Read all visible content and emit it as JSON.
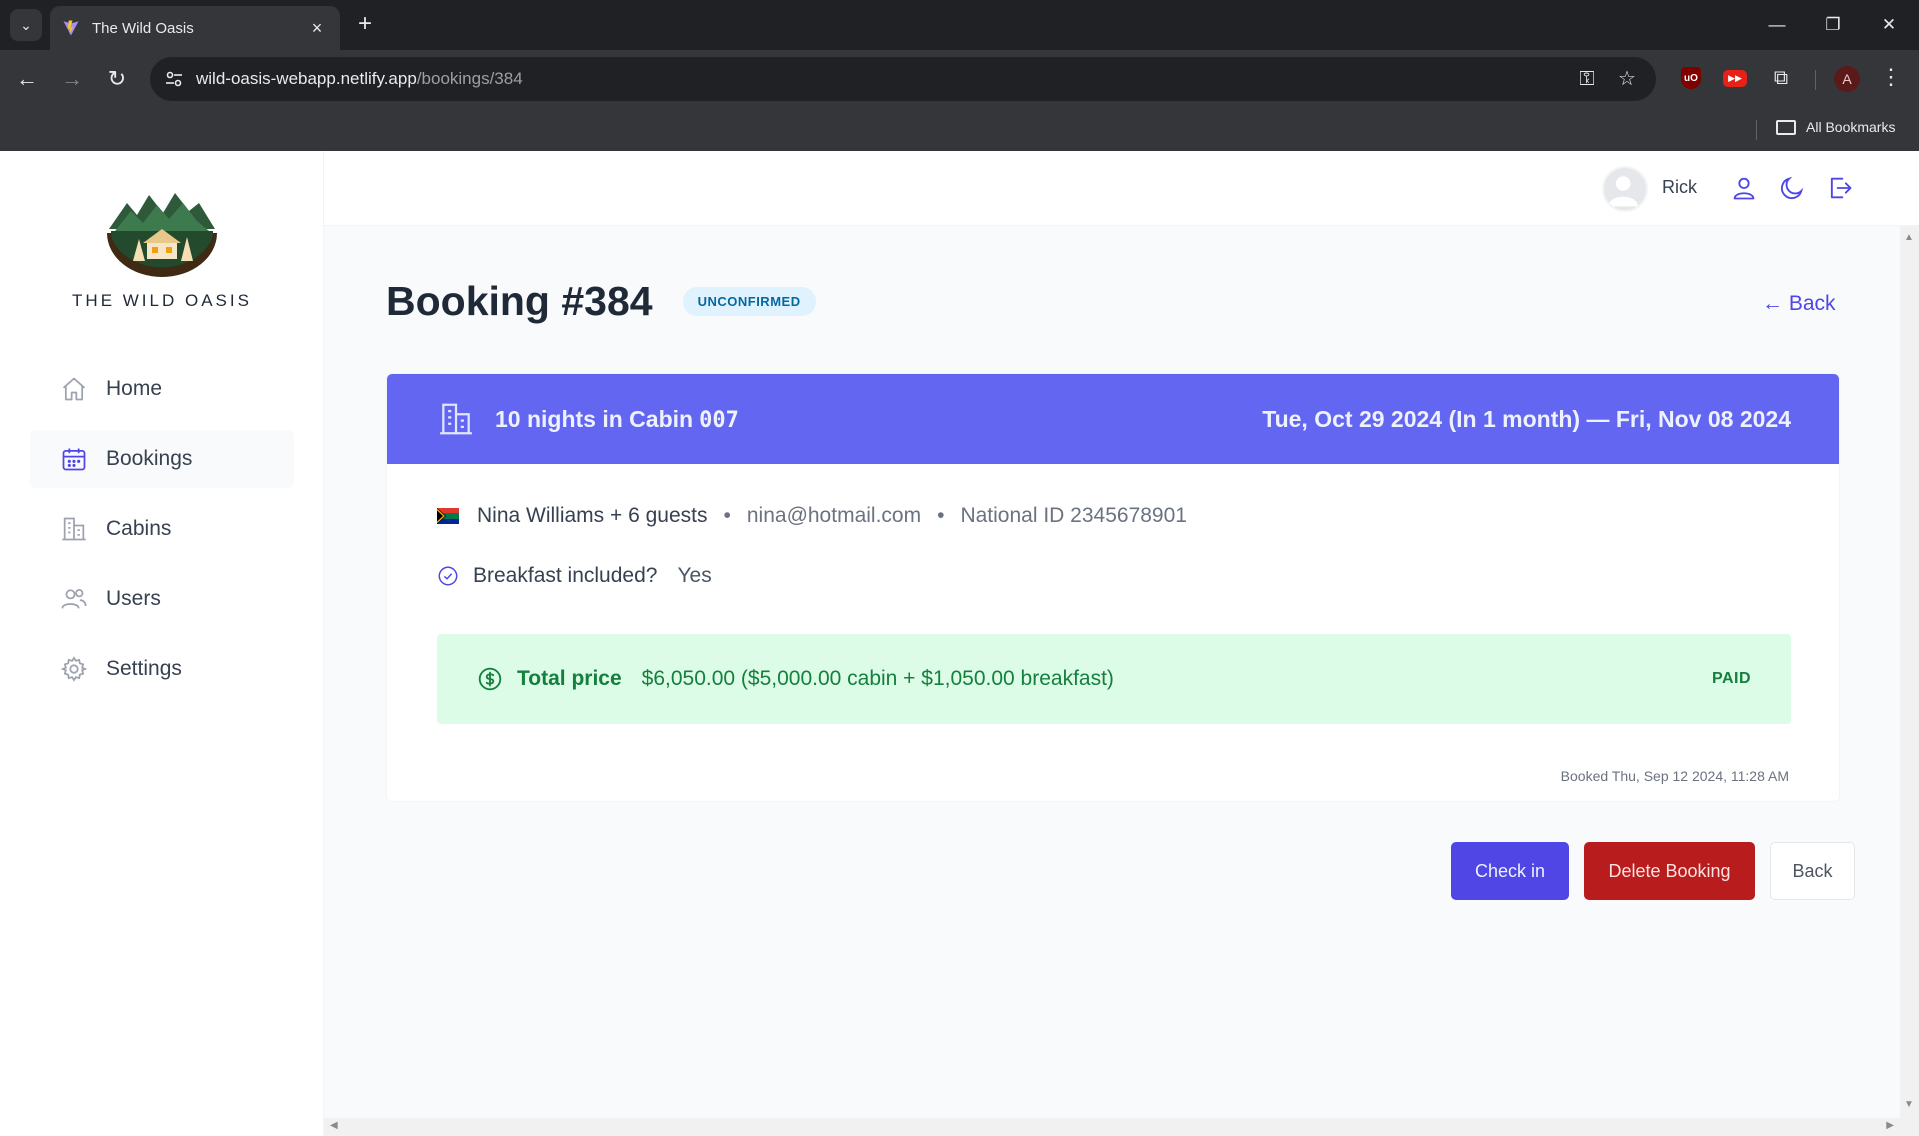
{
  "browser": {
    "tab_title": "The Wild Oasis",
    "url_host": "wild-oasis-webapp.netlify.app",
    "url_path": "/bookings/384",
    "bookmarks_label": "All Bookmarks",
    "profile_initial": "A"
  },
  "sidebar": {
    "logo_text": "THE WILD OASIS",
    "items": [
      {
        "label": "Home",
        "icon": "home-icon",
        "active": false
      },
      {
        "label": "Bookings",
        "icon": "calendar-icon",
        "active": true
      },
      {
        "label": "Cabins",
        "icon": "cabin-icon",
        "active": false
      },
      {
        "label": "Users",
        "icon": "users-icon",
        "active": false
      },
      {
        "label": "Settings",
        "icon": "gear-icon",
        "active": false
      }
    ]
  },
  "header": {
    "user_name": "Rick"
  },
  "booking": {
    "title": "Booking #384",
    "status": "UNCONFIRMED",
    "back_link": "← Back",
    "nights_text": "10 nights in Cabin",
    "cabin_code": "007",
    "dates": "Tue, Oct 29 2024 (In 1 month) — Fri, Nov 08 2024",
    "guest": "Nina Williams + 6 guests",
    "email": "nina@hotmail.com",
    "national_id": "National ID 2345678901",
    "breakfast_label": "Breakfast included?",
    "breakfast_value": "Yes",
    "price_label": "Total price",
    "price_value": "$6,050.00 ($5,000.00 cabin + $1,050.00 breakfast)",
    "paid_status": "PAID",
    "booked_at": "Booked Thu, Sep 12 2024, 11:28 AM"
  },
  "actions": {
    "check_in": "Check in",
    "delete": "Delete Booking",
    "back": "Back"
  },
  "colors": {
    "brand": "#4f46e5",
    "header_band": "#6366f1",
    "danger": "#b91c1c",
    "paid_bg": "#dcfce7",
    "paid_text": "#15803d",
    "tag_bg": "#e0f2fe",
    "tag_text": "#0369a1"
  }
}
